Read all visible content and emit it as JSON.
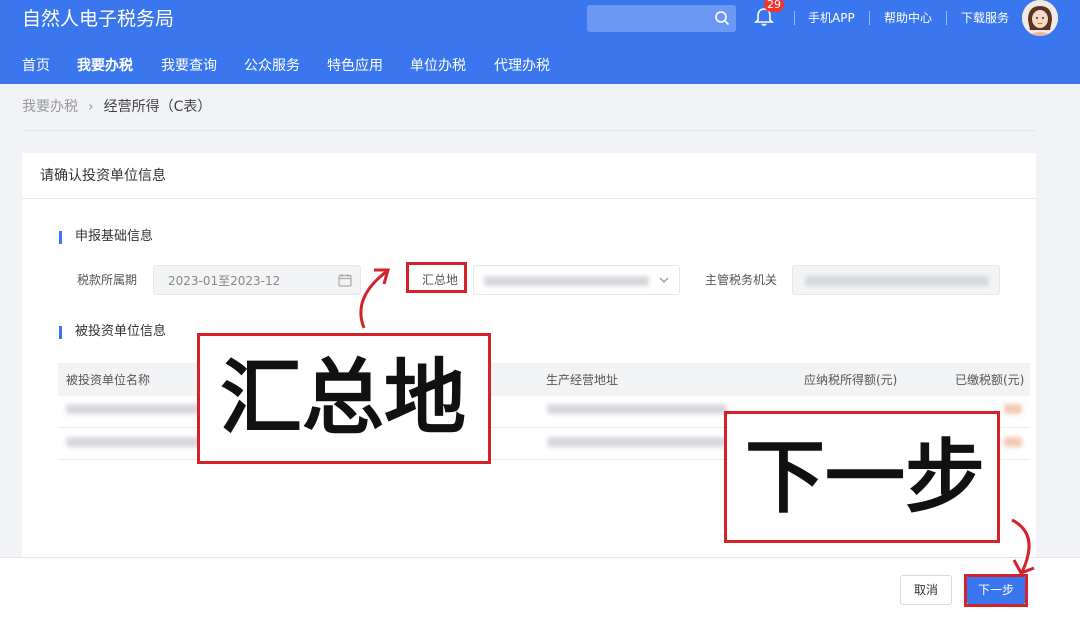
{
  "header": {
    "app_title": "自然人电子税务局",
    "badge_count": "29",
    "links": [
      "手机APP",
      "帮助中心",
      "下载服务"
    ]
  },
  "nav": {
    "items": [
      "首页",
      "我要办税",
      "我要查询",
      "公众服务",
      "特色应用",
      "单位办税",
      "代理办税"
    ],
    "active": "我要办税"
  },
  "breadcrumb": {
    "home": "我要办税",
    "current": "经营所得（C表）"
  },
  "card": {
    "title": "请确认投资单位信息",
    "basic": {
      "title": "申报基础信息",
      "period_label": "税款所属期",
      "period_value": "2023-01至2023-12",
      "location_label": "汇总地",
      "authority_label": "主管税务机关"
    },
    "invested": {
      "title": "被投资单位信息",
      "columns": [
        "被投资单位名称",
        "生产经营地址",
        "应纳税所得额(元)",
        "已缴税额(元)"
      ]
    }
  },
  "footer": {
    "cancel_label": "取消",
    "next_label": "下一步"
  },
  "callouts": {
    "location": "汇总地",
    "next": "下一步"
  },
  "colors": {
    "brand": "#3a77ee",
    "highlight": "#d3222a"
  }
}
